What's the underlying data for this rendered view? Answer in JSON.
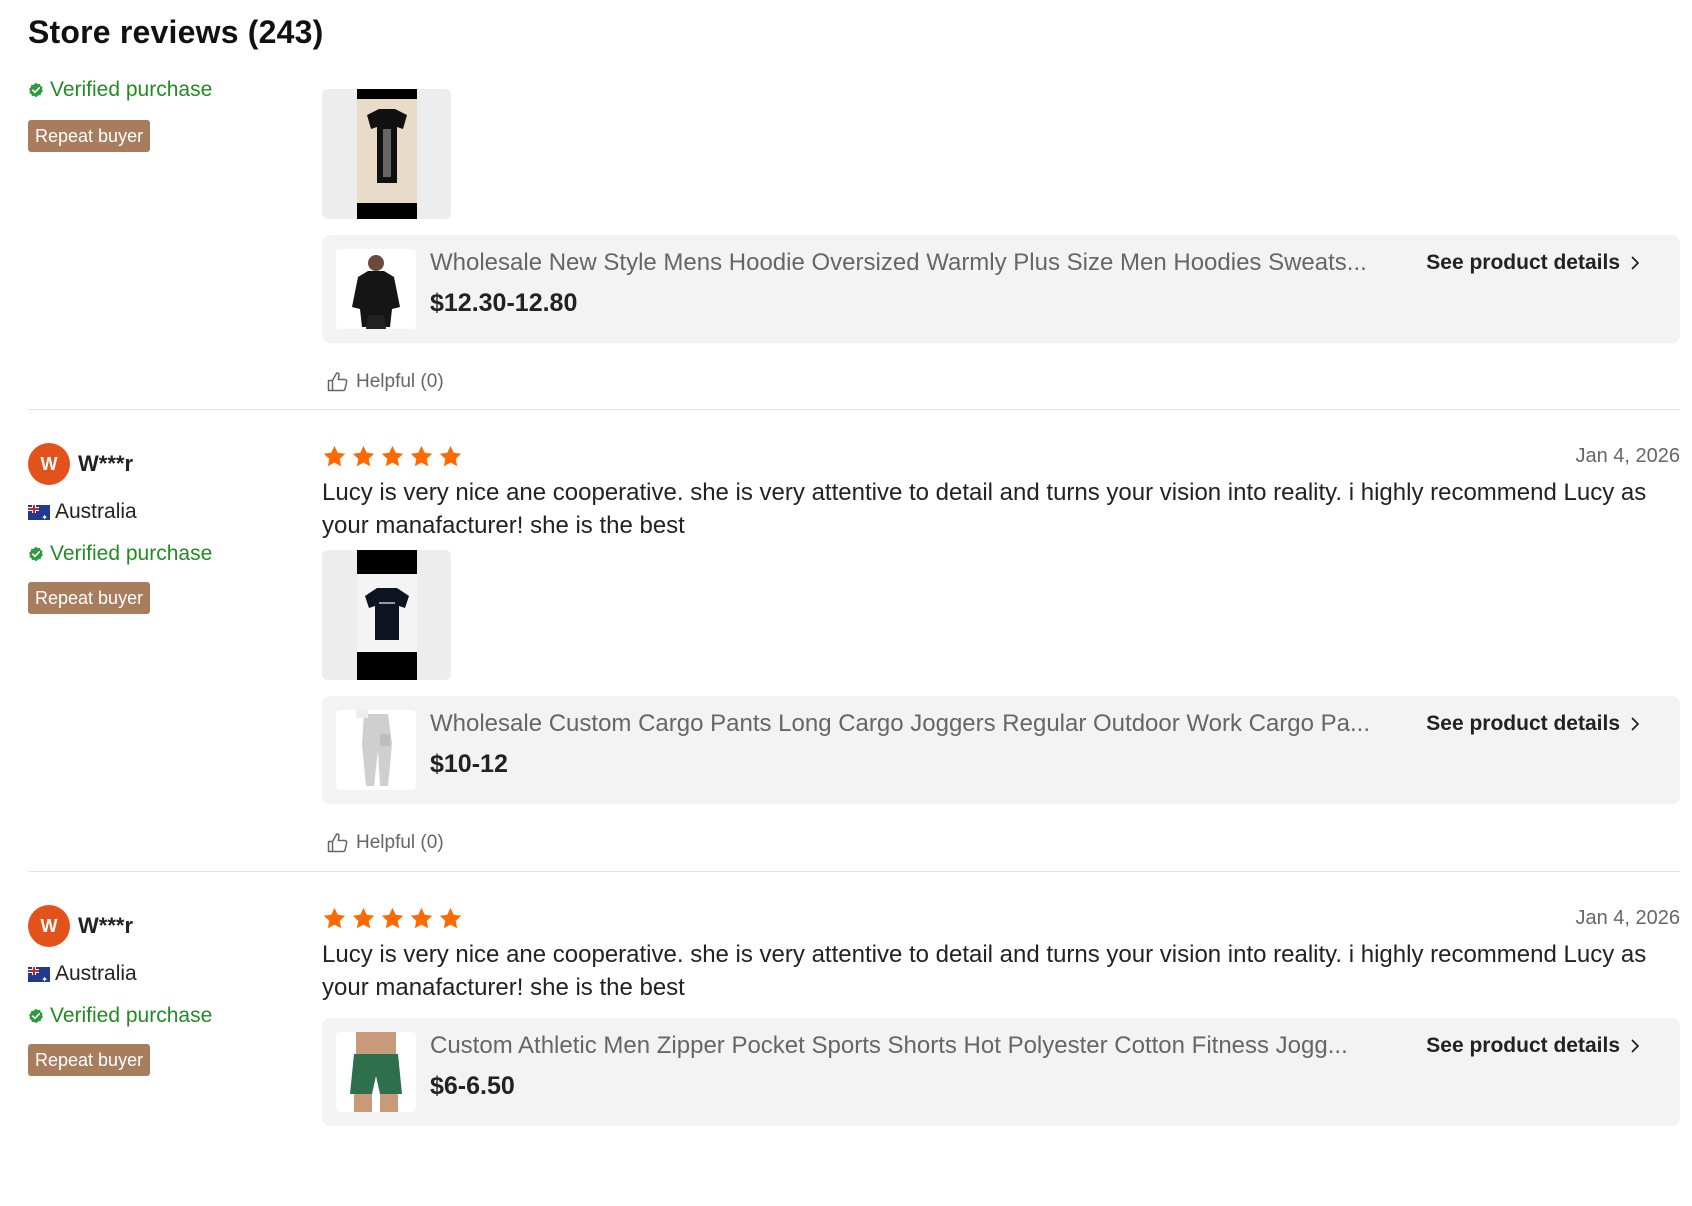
{
  "page_title": "Store reviews (243)",
  "colors": {
    "star": "#ff6a00",
    "verified": "#228b22",
    "repeat_badge": "#a87d5e",
    "avatar": "#e4521b"
  },
  "reviews": [
    {
      "reviewer_initial": "",
      "reviewer_name": "",
      "country": "",
      "verified_label": "Verified purchase",
      "repeat_label": "Repeat buyer",
      "stars": 0,
      "date": "",
      "comment": "",
      "media": [
        "tshirt-photo"
      ],
      "product": {
        "title": "Wholesale New Style Mens Hoodie Oversized Warmly Plus Size Men Hoodies Sweats...",
        "price": "$12.30-12.80",
        "details_label": "See product details"
      },
      "helpful_label": "Helpful (0)"
    },
    {
      "reviewer_initial": "W",
      "reviewer_name": "W***r",
      "country": "Australia",
      "verified_label": "Verified purchase",
      "repeat_label": "Repeat buyer",
      "stars": 5,
      "date": "Jan 4, 2026",
      "comment": "Lucy is very nice ane cooperative. she is very attentive to detail and turns your vision into reality. i highly recommend Lucy as your manafacturer! she is the best",
      "media": [
        "tshirt-photo"
      ],
      "product": {
        "title": "Wholesale Custom Cargo Pants Long Cargo Joggers Regular Outdoor Work Cargo Pa...",
        "price": "$10-12",
        "details_label": "See product details"
      },
      "helpful_label": "Helpful (0)"
    },
    {
      "reviewer_initial": "W",
      "reviewer_name": "W***r",
      "country": "Australia",
      "verified_label": "Verified purchase",
      "repeat_label": "Repeat buyer",
      "stars": 5,
      "date": "Jan 4, 2026",
      "comment": "Lucy is very nice ane cooperative. she is very attentive to detail and turns your vision into reality. i highly recommend Lucy as your manafacturer! she is the best",
      "media": [],
      "product": {
        "title": "Custom Athletic Men Zipper Pocket Sports Shorts Hot Polyester Cotton Fitness Jogg...",
        "price": "$6-6.50",
        "details_label": "See product details"
      },
      "helpful_label": ""
    }
  ]
}
